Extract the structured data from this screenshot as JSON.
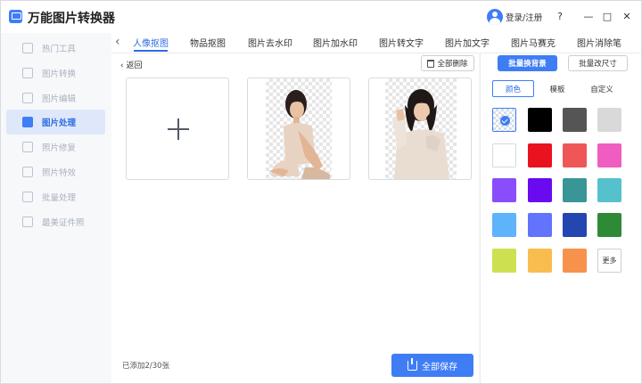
{
  "app": {
    "title": "万能图片转换器",
    "login_label": "登录/注册"
  },
  "window_controls": {
    "help": "?",
    "minimize": "—",
    "maximize": "□",
    "close": "✕"
  },
  "sidebar": {
    "items": [
      {
        "label": "热门工具",
        "icon": "fire-icon",
        "active": false
      },
      {
        "label": "图片转换",
        "icon": "convert-icon",
        "active": false
      },
      {
        "label": "图片编辑",
        "icon": "edit-icon",
        "active": false
      },
      {
        "label": "图片处理",
        "icon": "image-process-icon",
        "active": true
      },
      {
        "label": "照片修复",
        "icon": "photo-repair-icon",
        "active": false
      },
      {
        "label": "照片特效",
        "icon": "effects-icon",
        "active": false
      },
      {
        "label": "批量处理",
        "icon": "batch-icon",
        "active": false
      },
      {
        "label": "最美证件照",
        "icon": "id-photo-icon",
        "active": false
      }
    ]
  },
  "tabs": [
    {
      "label": "人像抠图",
      "active": true
    },
    {
      "label": "物品抠图",
      "active": false
    },
    {
      "label": "图片去水印",
      "active": false
    },
    {
      "label": "图片加水印",
      "active": false
    },
    {
      "label": "图片转文字",
      "active": false
    },
    {
      "label": "图片加文字",
      "active": false
    },
    {
      "label": "图片马赛克",
      "active": false
    },
    {
      "label": "图片消除笔",
      "active": false
    }
  ],
  "main": {
    "back_label": "返回",
    "delete_all_label": "全部删除",
    "count_text": "已添加2/30张",
    "save_all_label": "全部保存"
  },
  "right": {
    "batch_bg_label": "批量换背景",
    "batch_resize_label": "批量改尺寸",
    "subtabs": [
      {
        "label": "颜色",
        "active": true
      },
      {
        "label": "模板",
        "active": false
      },
      {
        "label": "自定义",
        "active": false
      }
    ],
    "colors": [
      "transparent",
      "#000000",
      "#555555",
      "#d9d9d9",
      "#ffffff",
      "#e8131f",
      "#ef5757",
      "#ee5dbf",
      "#8a4dfb",
      "#6a0af0",
      "#3a9597",
      "#55c1cc",
      "#5fb3fb",
      "#6274fb",
      "#2346b0",
      "#2f8a35",
      "#cde052",
      "#f8bd4e",
      "#f6924b"
    ],
    "more_label": "更多"
  }
}
